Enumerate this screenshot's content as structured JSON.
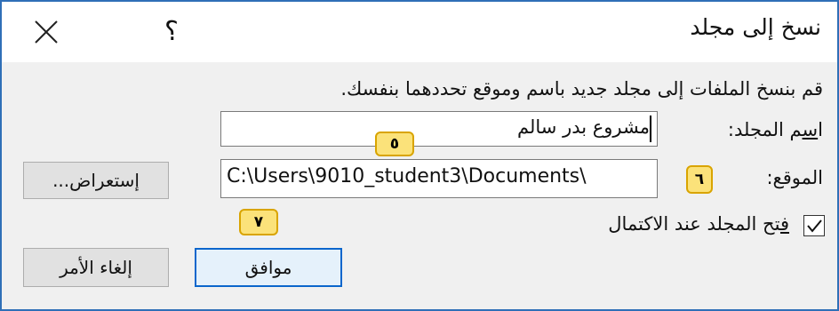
{
  "dialog": {
    "title": "نسخ إلى مجلد",
    "help_label": "؟",
    "description": "قم بنسخ الملفات إلى مجلد جديد باسم وموقع تحددهما بنفسك."
  },
  "folder_name": {
    "label_first": "ا",
    "label_ul": "س",
    "label_rest": "م المجلد:",
    "value": "مشروع بدر سالم"
  },
  "location": {
    "label": "الموقع:",
    "value": "C:\\Users\\9010_student3\\Documents\\"
  },
  "buttons": {
    "browse_ul": "إ",
    "browse_rest": "ستعراض...",
    "ok": "موافق",
    "cancel": "إلغاء الأمر"
  },
  "open_on_complete": {
    "checked": true,
    "label_ul": "ف",
    "label_rest": "تح المجلد عند الاكتمال"
  },
  "badges": {
    "b5": "٥",
    "b6": "٦",
    "b7": "٧"
  }
}
